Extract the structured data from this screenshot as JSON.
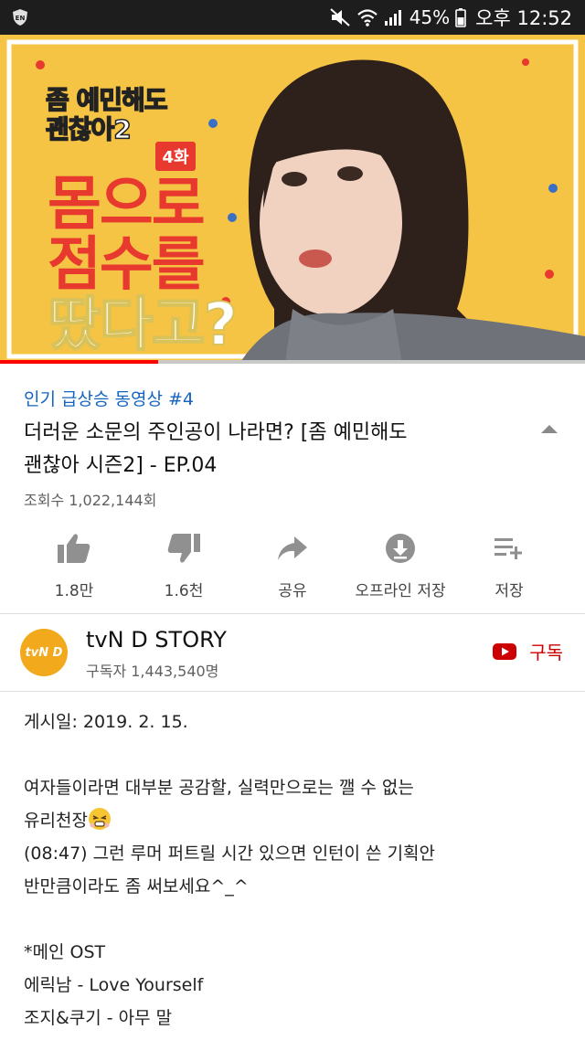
{
  "status_bar": {
    "left_badge": "EN",
    "battery": "45%",
    "time": "오후 12:52",
    "icons": [
      "mute-icon",
      "wifi-icon",
      "signal-icon",
      "battery-icon"
    ]
  },
  "video": {
    "thumbnail": {
      "logo_line1": "좀 예민해도",
      "logo_line2": "괜찮아2",
      "episode_badge": "4화",
      "headline_line1": "몸으로",
      "headline_line2": "점수를",
      "headline_line3": "땄다고?"
    },
    "progress_fraction": 0.27,
    "accent_color": "#ff0000"
  },
  "info": {
    "trending_label": "인기 급상승 동영상 #4",
    "title_line1": "더러운 소문의 주인공이 나라면? [좀 예민해도",
    "title_line2": "괜찮아 시즌2] - EP.04",
    "views": "조회수 1,022,144회"
  },
  "actions": {
    "like": "1.8만",
    "dislike": "1.6천",
    "share": "공유",
    "offline": "오프라인 저장",
    "save": "저장"
  },
  "channel": {
    "avatar_text": "tvN D",
    "name": "tvN D STORY",
    "subscribers": "구독자 1,443,540명",
    "subscribe_label": "구독",
    "subscribe_color": "#cc0000"
  },
  "description": {
    "posted": "게시일: 2019. 2. 15.",
    "line1": "여자들이라면 대부분 공감할, 실력만으로는 깰 수 없는",
    "line2": "유리천장",
    "line3": "(08:47) 그런 루머 퍼트릴 시간 있으면 인턴이 쓴 기획안",
    "line4": "반만큼이라도 좀 써보세요^_^",
    "line5": "*메인 OST",
    "line6": "에릭남 - Love Yourself",
    "line7": "조지&쿠기 - 아무 말"
  }
}
